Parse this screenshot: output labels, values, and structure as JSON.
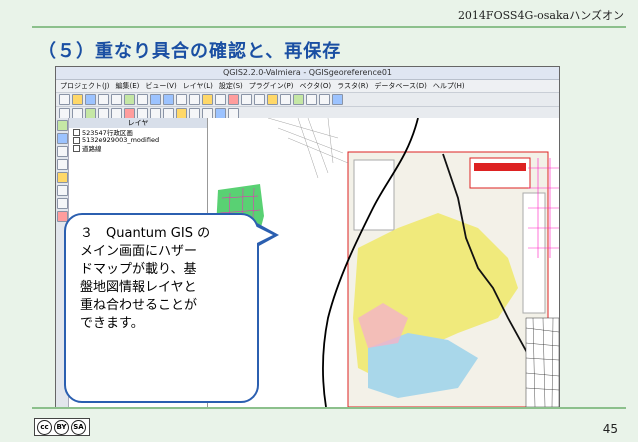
{
  "header": {
    "title": "2014FOSS4G-osakaハンズオン"
  },
  "slide": {
    "title": "（５）重なり具合の確認と、再保存"
  },
  "qgis": {
    "window_title": "QGIS2.2.0-Valmiera - QGISgeoreference01",
    "menus": [
      "プロジェクト(J)",
      "編集(E)",
      "ビュー(V)",
      "レイヤ(L)",
      "設定(S)",
      "プラグイン(P)",
      "ベクタ(O)",
      "ラスタ(R)",
      "データベース(D)",
      "ヘルプ(H)"
    ],
    "layer_panel_title": "レイヤ",
    "layers": [
      "523547行政区画",
      "5132e929003_modified",
      "道路線"
    ]
  },
  "callout": {
    "lines": [
      "３　Quantum GIS の",
      "メイン画面にハザー",
      "ドマップが載り、基",
      "盤地図情報レイヤと",
      "重ね合わせることが",
      "できます。"
    ]
  },
  "footer": {
    "page_number": "45",
    "license": [
      "cc",
      "BY",
      "SA"
    ]
  }
}
